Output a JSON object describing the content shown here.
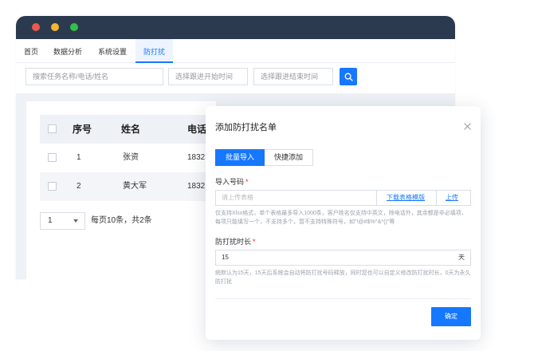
{
  "nav": {
    "items": [
      "首页",
      "数据分析",
      "系统设置",
      "防打扰"
    ]
  },
  "search": {
    "keyword_placeholder": "搜索任务名称/电话/姓名",
    "start_placeholder": "选择跟进开始时间",
    "end_placeholder": "选择跟进结束时间",
    "button_icon": "search-icon"
  },
  "table": {
    "headers": [
      "序号",
      "姓名",
      "电话"
    ],
    "rows": [
      [
        "1",
        "张资",
        "1832"
      ],
      [
        "2",
        "黄大军",
        "1832"
      ]
    ]
  },
  "pager": {
    "page_value": "1",
    "summary": "每页10条，共2条"
  },
  "modal": {
    "title": "添加防打扰名单",
    "close_icon": "close-icon",
    "tabs": [
      "批量导入",
      "快捷添加"
    ],
    "import_label": "导入号码",
    "required_mark": "*",
    "upload_placeholder": "请上传表格",
    "download_template": "下载表格模版",
    "upload_link": "上传",
    "import_hint": "仅支持Xlsx格式，单个表格最多导入1000条，客户姓名仅支持中英文，除电话外，其余都是非必填项，每项只能填写一个，不支持多个，暂不支持特殊符号，如\"!@#$%^&*()\"等",
    "duration_label": "防打扰时长",
    "duration_value": "15",
    "duration_unit": "天",
    "duration_hint": "统默认为15天，15天后系统会自动将防打扰号码释放，同时您也可以自定义修改防打扰时长，0天为永久防打扰",
    "confirm_label": "确定"
  },
  "colors": {
    "accent": "#1677ff",
    "titlebar": "#2b3a4f",
    "required": "#f5222d"
  }
}
